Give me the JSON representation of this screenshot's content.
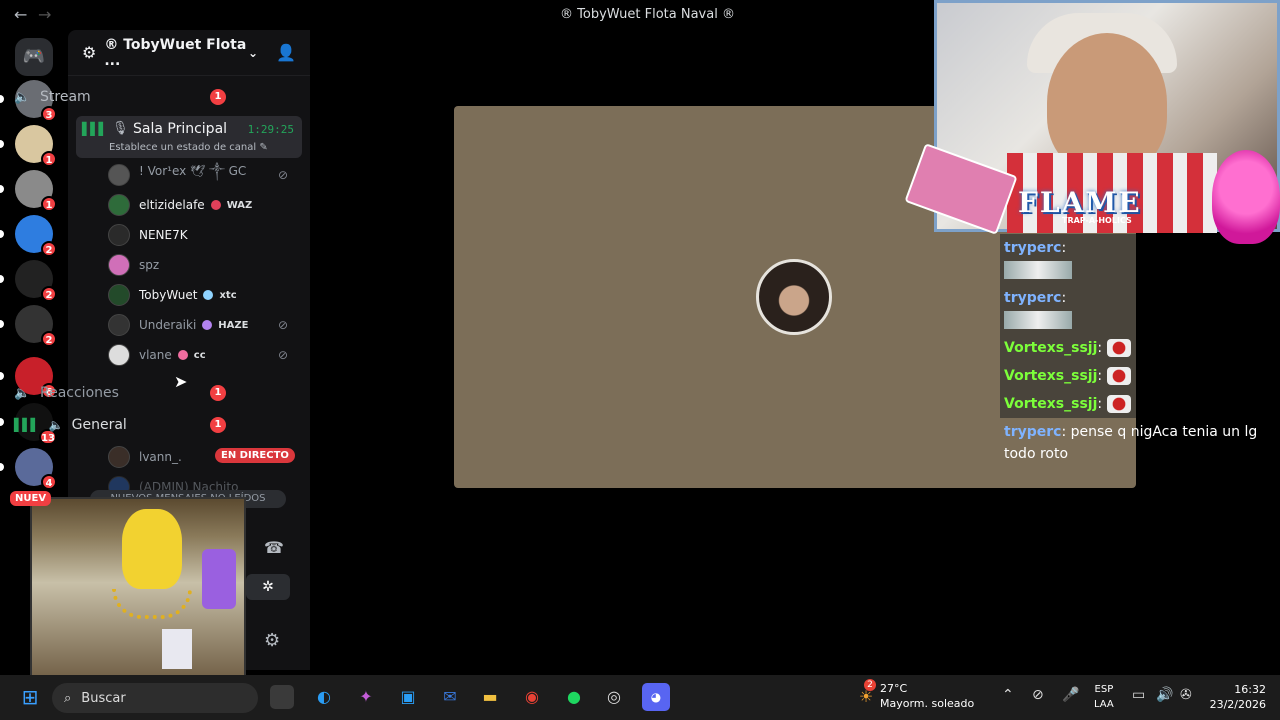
{
  "window": {
    "title": "® TobyWuet Flota Naval ®",
    "back": "←",
    "forward": "→"
  },
  "guilds": [
    {
      "badge": "3",
      "color": "#6a6d73"
    },
    {
      "badge": "1",
      "color": "#d9c7a0"
    },
    {
      "badge": "1",
      "color": "#8a8a8a"
    },
    {
      "badge": "2",
      "color": "#2e7de0"
    },
    {
      "badge": "2",
      "color": "#222222"
    },
    {
      "badge": "2",
      "color": "#333333"
    },
    {
      "badge": "6",
      "color": "#c8202a"
    },
    {
      "badge": "13",
      "color": "#111111"
    },
    {
      "badge": "4",
      "color": "#5a6a9a"
    }
  ],
  "nuevo_badge": "NUEV",
  "server": {
    "name": "® TobyWuet Flota ...",
    "chevron": "⌄",
    "invite_icon": "person-add"
  },
  "channels": {
    "stream": {
      "name": "Stream",
      "count": "1"
    },
    "sala": {
      "name": "Sala Principal",
      "time": "1:29:25",
      "status": "Establece un estado de canal ✎"
    },
    "reacciones": {
      "name": "Reacciones",
      "count": "1"
    },
    "general": {
      "name": "General",
      "count": "1"
    }
  },
  "members": [
    {
      "name": "! Vor¹ex 🕊 ༒ GC",
      "tag": "",
      "muted": true,
      "color": "#949ba4"
    },
    {
      "name": "eltizidelafe",
      "tag": "WAZ",
      "muted": false,
      "color": "#f2f3f5"
    },
    {
      "name": "NENE7K",
      "tag": "",
      "muted": false,
      "color": "#f2f3f5"
    },
    {
      "name": "spz",
      "tag": "",
      "muted": false,
      "color": "#949ba4"
    },
    {
      "name": "TobyWuet",
      "tag": "xtc",
      "muted": false,
      "color": "#f2f3f5"
    },
    {
      "name": "Underaiki",
      "tag": "HAZE",
      "muted": true,
      "color": "#949ba4"
    },
    {
      "name": "vlane",
      "tag": "cc",
      "muted": true,
      "color": "#949ba4"
    }
  ],
  "general_members": [
    {
      "name": "lvann_.",
      "live": "EN DIRECTO"
    },
    {
      "name": "(ADMIN) Nachito"
    }
  ],
  "new_messages": "NUEVOS MENSAJES NO LEÍDOS",
  "overlay": {
    "flame": "FLAME",
    "flame_sub": "TRAP-A-HOLICS"
  },
  "chat": [
    {
      "user": "tryperc",
      "color": "#7fb3ff",
      "text": "",
      "emote": "wide"
    },
    {
      "user": "tryperc",
      "color": "#7fb3ff",
      "text": "",
      "emote": "wide"
    },
    {
      "user": "Vortexs_ssjj",
      "color": "#7cff3a",
      "text": "",
      "emote": "small"
    },
    {
      "user": "Vortexs_ssjj",
      "color": "#7cff3a",
      "text": "",
      "emote": "small"
    },
    {
      "user": "Vortexs_ssjj",
      "color": "#7cff3a",
      "text": "",
      "emote": "small"
    },
    {
      "user": "tryperc",
      "color": "#7fb3ff",
      "text": "pense q nigAca tenia un lg todo roto",
      "emote": ""
    }
  ],
  "taskbar": {
    "search_placeholder": "Buscar",
    "weather_temp": "27°C",
    "weather_desc": "Mayorm. soleado",
    "weather_badge": "2",
    "lang_1": "ESP",
    "lang_2": "LAA",
    "time": "16:32",
    "date": "23/2/2026"
  }
}
